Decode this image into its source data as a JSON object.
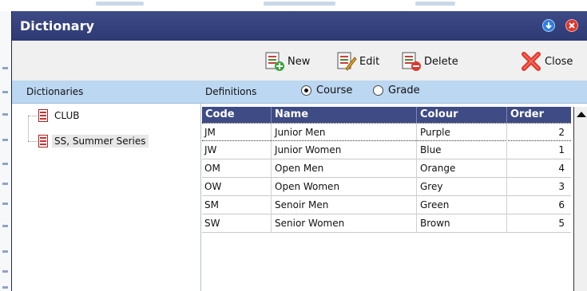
{
  "window": {
    "title": "Dictionary",
    "colors": {
      "titlebar": "#2f3c77",
      "header_bar": "#bcd7f1",
      "grid_header": "#3e4b84",
      "close_icon": "#e0342a"
    }
  },
  "titlebar_buttons": [
    {
      "icon": "download-arrow-icon"
    },
    {
      "icon": "close-circle-icon"
    }
  ],
  "toolbar": {
    "new_label": "New",
    "edit_label": "Edit",
    "delete_label": "Delete",
    "close_label": "Close"
  },
  "header": {
    "dictionaries_label": "Dictionaries",
    "definitions_label": "Definitions",
    "radio_options": [
      {
        "label": "Course",
        "selected": true
      },
      {
        "label": "Grade",
        "selected": false
      }
    ]
  },
  "tree": {
    "items": [
      {
        "label": "CLUB",
        "selected": false
      },
      {
        "label": "SS, Summer Series",
        "selected": true
      }
    ]
  },
  "table": {
    "columns": [
      "Code",
      "Name",
      "Colour",
      "Order"
    ],
    "rows": [
      {
        "code": "JM",
        "name": "Junior Men",
        "colour": "Purple",
        "order": "2"
      },
      {
        "code": "JW",
        "name": "Junior Women",
        "colour": "Blue",
        "order": "1"
      },
      {
        "code": "OM",
        "name": "Open Men",
        "colour": "Orange",
        "order": "4"
      },
      {
        "code": "OW",
        "name": "Open Women",
        "colour": "Grey",
        "order": "3"
      },
      {
        "code": "SM",
        "name": "Senoir Men",
        "colour": "Green",
        "order": "6"
      },
      {
        "code": "SW",
        "name": "Senior Women",
        "colour": "Brown",
        "order": "5"
      }
    ]
  }
}
